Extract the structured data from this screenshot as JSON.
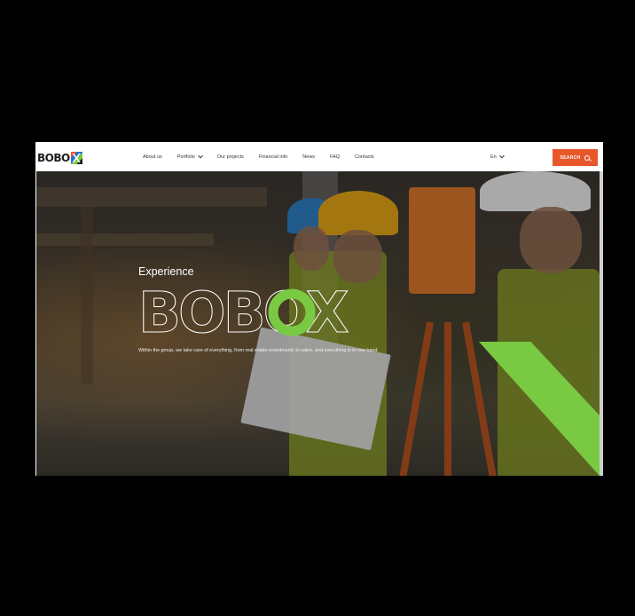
{
  "header": {
    "logo_text": "BOBO",
    "logo_icon": "bobox-x-logo",
    "nav": [
      {
        "label": "About us",
        "dropdown": false
      },
      {
        "label": "Portfolio",
        "dropdown": true
      },
      {
        "label": "Our projects",
        "dropdown": false
      },
      {
        "label": "Financial info",
        "dropdown": false
      },
      {
        "label": "News",
        "dropdown": false
      },
      {
        "label": "FAQ",
        "dropdown": false
      },
      {
        "label": "Contacts",
        "dropdown": false
      }
    ],
    "language": "En",
    "search_label": "SEARCH"
  },
  "hero": {
    "kicker": "Experience",
    "brand": "BOBOX",
    "tagline": "Within the group, we take care of everything, from real estate investments to sales, and everything is in one hand."
  },
  "colors": {
    "accent_green": "#7ac943",
    "accent_orange": "#e8572a",
    "header_bg": "#ffffff"
  }
}
